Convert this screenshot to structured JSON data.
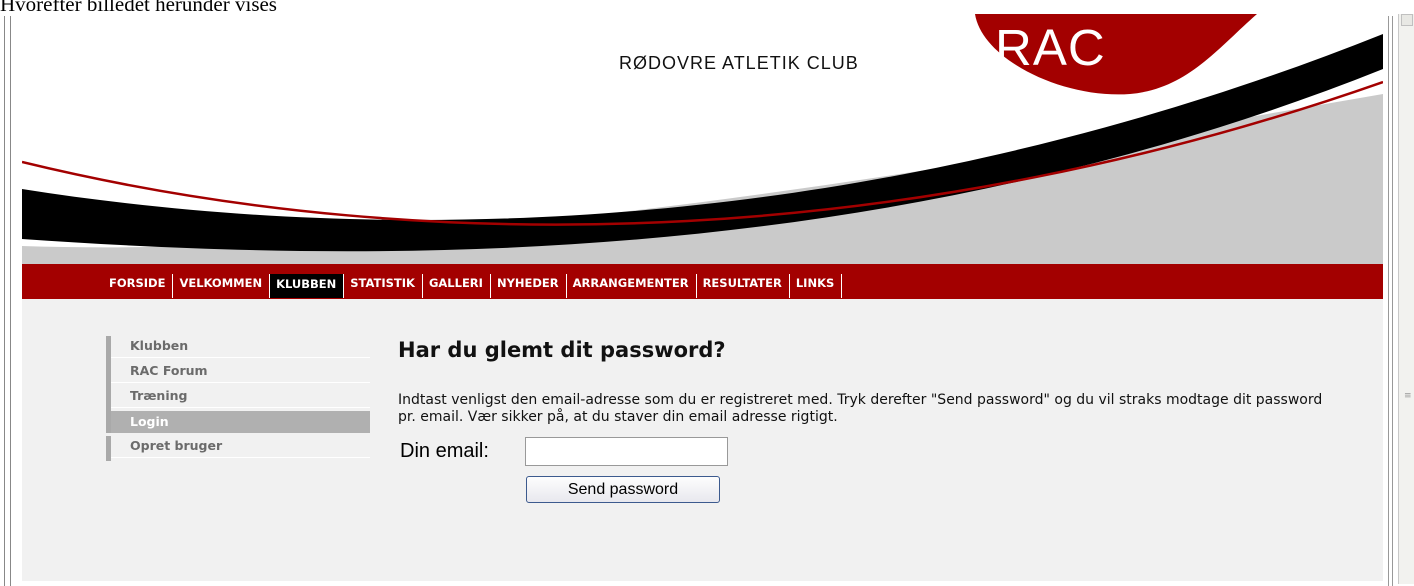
{
  "caption": "Hvorefter billedet herunder vises",
  "header": {
    "club_name": "RØDOVRE ATLETIK CLUB",
    "logo_text": "RAC"
  },
  "nav": {
    "items": [
      "FORSIDE",
      "VELKOMMEN",
      "KLUBBEN",
      "STATISTIK",
      "GALLERI",
      "NYHEDER",
      "ARRANGEMENTER",
      "RESULTATER",
      "LINKS"
    ],
    "active": "KLUBBEN"
  },
  "submenu": {
    "items": [
      "Klubben",
      "RAC Forum",
      "Træning",
      "Login",
      "Opret bruger"
    ],
    "active": "Login"
  },
  "main": {
    "title": "Har du glemt dit password?",
    "intro": "Indtast venligst den email-adresse som du er registreret med. Tryk derefter \"Send password\" og du vil straks modtage dit password pr. email. Vær sikker på, at du staver din email adresse rigtigt.",
    "email_label": "Din email:",
    "email_value": "",
    "send_label": "Send password"
  },
  "colors": {
    "brand_red": "#a30000",
    "active_nav": "#000000",
    "submenu_active": "#b0b0b0"
  }
}
